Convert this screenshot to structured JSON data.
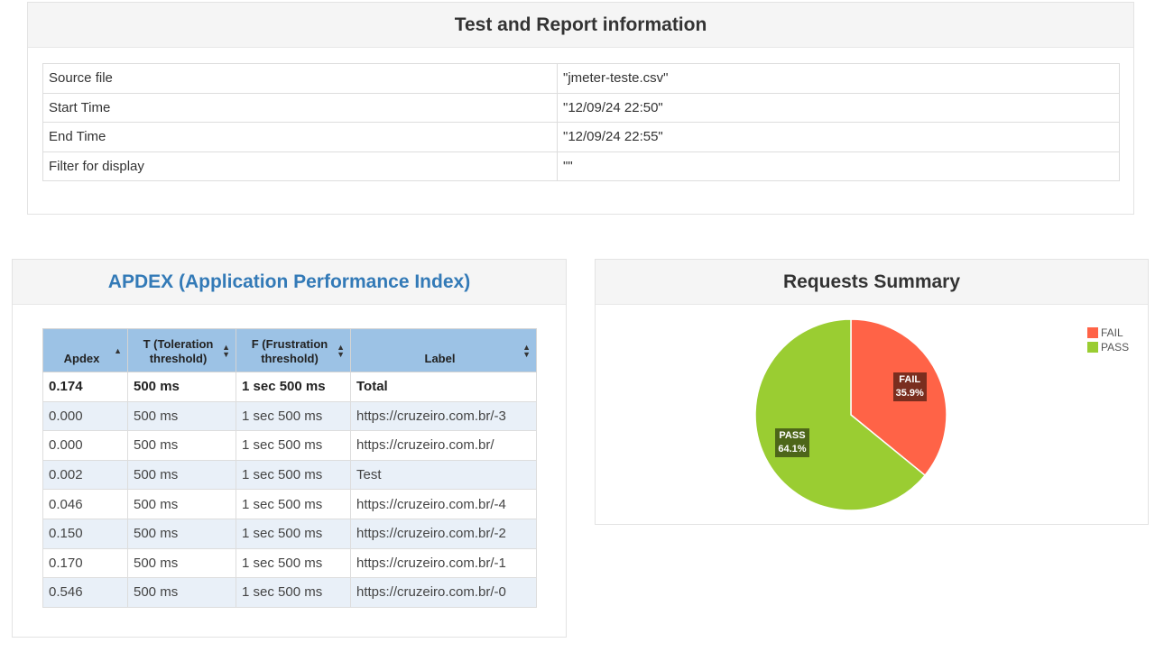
{
  "info": {
    "title": "Test and Report information",
    "rows": [
      {
        "key": "Source file",
        "value": "\"jmeter-teste.csv\""
      },
      {
        "key": "Start Time",
        "value": "\"12/09/24 22:50\""
      },
      {
        "key": "End Time",
        "value": "\"12/09/24 22:55\""
      },
      {
        "key": "Filter for display",
        "value": "\"\""
      }
    ]
  },
  "apdex": {
    "title": "APDEX (Application Performance Index)",
    "headers": {
      "apdex": "Apdex",
      "t_line1": "T (Toleration",
      "t_line2": "threshold)",
      "f_line1": "F (Frustration",
      "f_line2": "threshold)",
      "label": "Label"
    },
    "rows": [
      {
        "apdex": "0.174",
        "t": "500 ms",
        "f": "1 sec 500 ms",
        "label": "Total"
      },
      {
        "apdex": "0.000",
        "t": "500 ms",
        "f": "1 sec 500 ms",
        "label": "https://cruzeiro.com.br/-3"
      },
      {
        "apdex": "0.000",
        "t": "500 ms",
        "f": "1 sec 500 ms",
        "label": "https://cruzeiro.com.br/"
      },
      {
        "apdex": "0.002",
        "t": "500 ms",
        "f": "1 sec 500 ms",
        "label": "Test"
      },
      {
        "apdex": "0.046",
        "t": "500 ms",
        "f": "1 sec 500 ms",
        "label": "https://cruzeiro.com.br/-4"
      },
      {
        "apdex": "0.150",
        "t": "500 ms",
        "f": "1 sec 500 ms",
        "label": "https://cruzeiro.com.br/-2"
      },
      {
        "apdex": "0.170",
        "t": "500 ms",
        "f": "1 sec 500 ms",
        "label": "https://cruzeiro.com.br/-1"
      },
      {
        "apdex": "0.546",
        "t": "500 ms",
        "f": "1 sec 500 ms",
        "label": "https://cruzeiro.com.br/-0"
      }
    ]
  },
  "summary": {
    "title": "Requests Summary"
  },
  "chart_data": {
    "type": "pie",
    "categories": [
      "FAIL",
      "PASS"
    ],
    "values": [
      35.9,
      64.1
    ],
    "value_labels": [
      "35.9%",
      "64.1%"
    ],
    "colors": [
      "#ff6347",
      "#9acd32"
    ],
    "legend": "top-right"
  }
}
